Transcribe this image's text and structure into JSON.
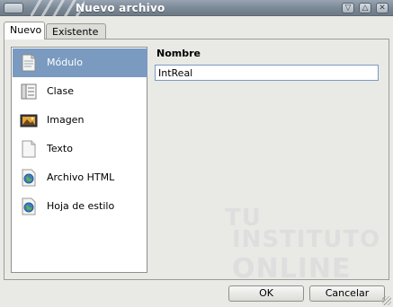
{
  "window": {
    "title": "Nuevo archivo",
    "controls": {
      "minimize": "▽",
      "maximize": "△",
      "close": "✕"
    }
  },
  "tabs": [
    {
      "label": "Nuevo",
      "active": true
    },
    {
      "label": "Existente",
      "active": false
    }
  ],
  "file_types": [
    {
      "label": "Módulo",
      "icon": "module-doc-icon",
      "selected": true
    },
    {
      "label": "Clase",
      "icon": "class-doc-icon",
      "selected": false
    },
    {
      "label": "Imagen",
      "icon": "image-icon",
      "selected": false
    },
    {
      "label": "Texto",
      "icon": "text-doc-icon",
      "selected": false
    },
    {
      "label": "Archivo HTML",
      "icon": "html-globe-icon",
      "selected": false
    },
    {
      "label": "Hoja de estilo",
      "icon": "stylesheet-globe-icon",
      "selected": false
    }
  ],
  "form": {
    "name_label": "Nombre",
    "name_value": "IntReal"
  },
  "buttons": {
    "ok": "OK",
    "cancel": "Cancelar"
  },
  "watermark": {
    "line1": "TU",
    "line2": "INSTITUTO",
    "line3": "ONLINE"
  },
  "colors": {
    "selection": "#7a9ac0",
    "titlebar": "#7a8794"
  }
}
